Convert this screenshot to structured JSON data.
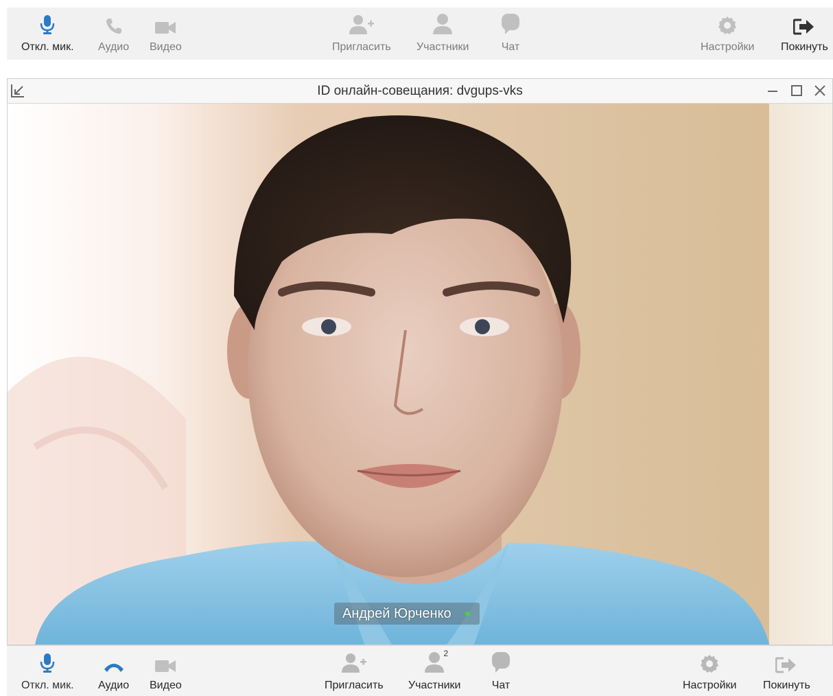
{
  "colors": {
    "accent": "#2a7bc4",
    "icon_gray": "#b8b8b8",
    "status_online": "#4cd137"
  },
  "toolbar_top": {
    "mute": {
      "label": "Откл. мик.",
      "icon": "microphone-icon"
    },
    "audio": {
      "label": "Аудио",
      "icon": "phone-icon"
    },
    "video": {
      "label": "Видео",
      "icon": "video-camera-icon"
    },
    "invite": {
      "label": "Пригласить",
      "icon": "add-user-icon"
    },
    "participants": {
      "label": "Участники",
      "icon": "user-icon"
    },
    "chat": {
      "label": "Чат",
      "icon": "chat-bubble-icon"
    },
    "settings": {
      "label": "Настройки",
      "icon": "gear-icon"
    },
    "leave": {
      "label": "Покинуть",
      "icon": "exit-icon"
    }
  },
  "window": {
    "title": "ID онлайн-совещания: dvgups-vks",
    "participant_name": "Андрей Юрченко"
  },
  "toolbar_bottom": {
    "mute": {
      "label": "Откл. мик.",
      "icon": "microphone-icon"
    },
    "audio": {
      "label": "Аудио",
      "icon": "hang-up-phone-icon"
    },
    "video": {
      "label": "Видео",
      "icon": "video-camera-icon"
    },
    "invite": {
      "label": "Пригласить",
      "icon": "add-user-icon"
    },
    "participants": {
      "label": "Участники",
      "icon": "user-icon",
      "count": "2"
    },
    "chat": {
      "label": "Чат",
      "icon": "chat-bubble-icon"
    },
    "settings": {
      "label": "Настройки",
      "icon": "gear-icon"
    },
    "leave": {
      "label": "Покинуть",
      "icon": "exit-icon"
    }
  }
}
